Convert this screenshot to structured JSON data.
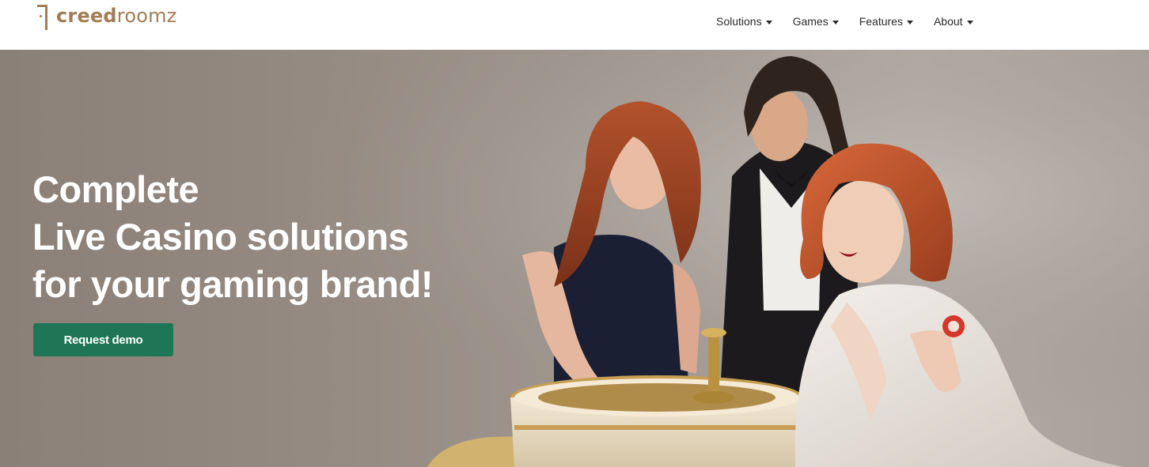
{
  "header": {
    "logo": {
      "bold": "creed",
      "light": "roomz"
    },
    "nav": [
      {
        "label": "Solutions"
      },
      {
        "label": "Games"
      },
      {
        "label": "Features"
      },
      {
        "label": "About"
      }
    ]
  },
  "hero": {
    "headline": [
      "Complete",
      "Live Casino solutions",
      "for your gaming brand!"
    ],
    "cta_label": "Request demo"
  },
  "colors": {
    "brand": "#a27d56",
    "cta": "#1f7656",
    "nav_text": "#2b2b2b"
  }
}
